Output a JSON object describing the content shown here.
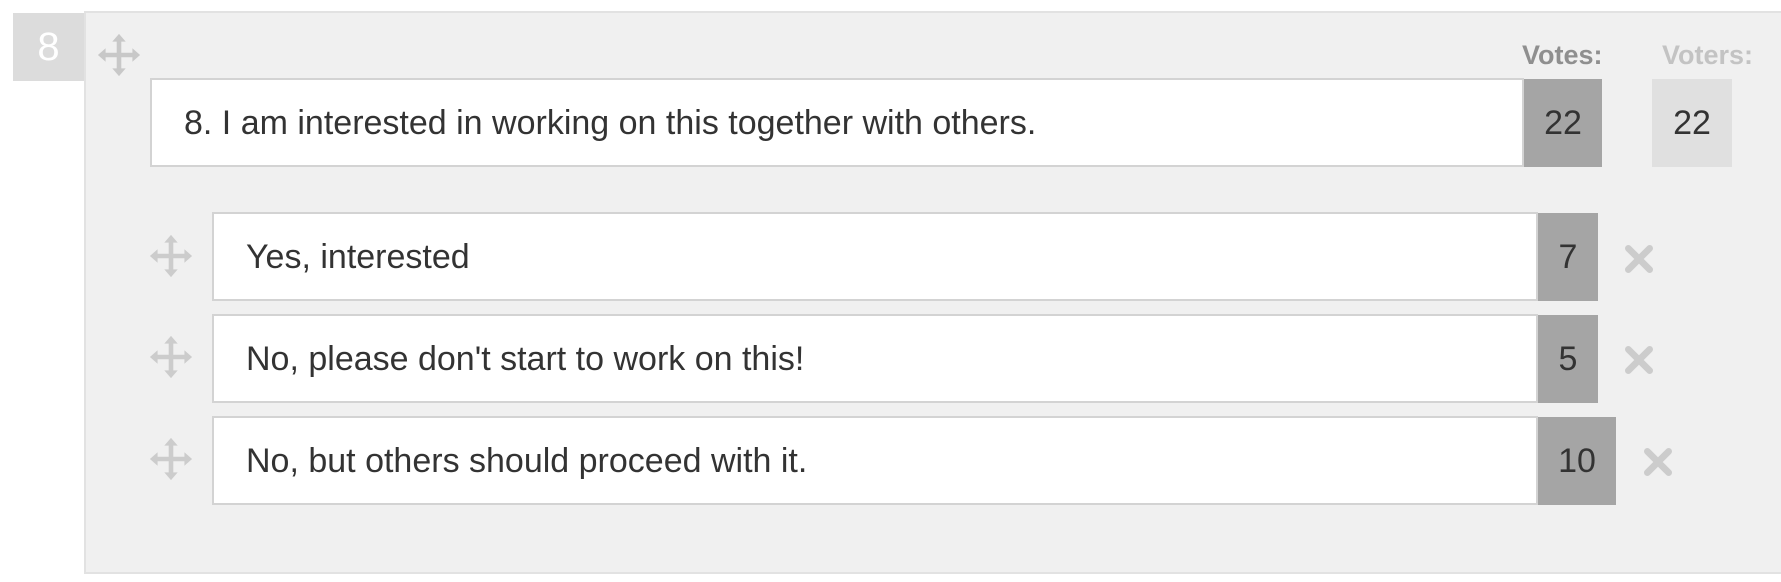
{
  "question": {
    "number": "8",
    "text": "8. I am interested in working on this together with others.",
    "votes": "22",
    "voters": "22"
  },
  "headers": {
    "votes": "Votes:",
    "voters": "Voters:"
  },
  "options": [
    {
      "text": "Yes, interested",
      "votes": "7"
    },
    {
      "text": "No, please don't start to work on this!",
      "votes": "5"
    },
    {
      "text": "No, but others should proceed with it.",
      "votes": "10"
    }
  ],
  "icons": {
    "drag": "move-arrows-icon",
    "remove": "close-x-icon"
  },
  "colors": {
    "panel_bg": "#f0f0f0",
    "number_bg": "#dcdcdc",
    "votes_bg": "#a5a5a5",
    "voters_bg": "#e0e0e0",
    "icon": "#cccccc"
  }
}
